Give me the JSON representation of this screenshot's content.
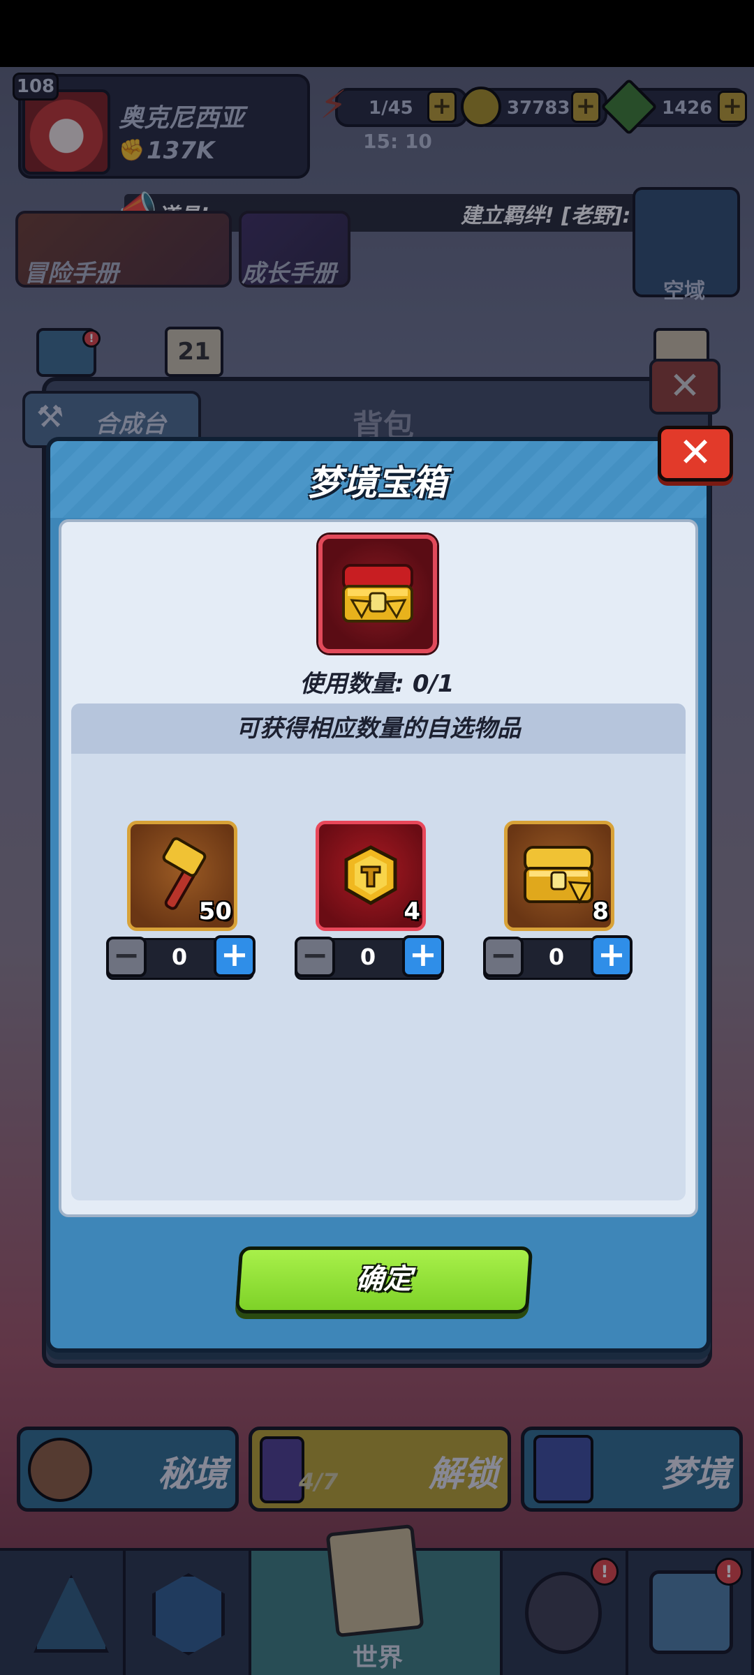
{
  "colors": {
    "modal_frame": "#3e86b8",
    "modal_body": "#e4ecf6",
    "close_red": "#e23a2a",
    "confirm_green": "#8ee035",
    "plus_blue": "#2f8ee8",
    "gold_border": "#d8a238",
    "red_border": "#e8485a"
  },
  "player": {
    "level": "108",
    "name": "奥克尼西亚",
    "power": "137K"
  },
  "resources": {
    "energy": "1/45",
    "energy_timer": "15: 10",
    "gold": "37783",
    "gems": "1426"
  },
  "ticker": {
    "left_text": "道具!",
    "right_text": "建立羁绊! [老野]:"
  },
  "menu": {
    "adventure_manual": "冒险手册",
    "growth_manual": "成长手册",
    "airspace": "空域",
    "calendar_day": "21"
  },
  "backpack": {
    "tab_label": "合成台",
    "title": "背包"
  },
  "modal": {
    "title": "梦境宝箱",
    "chest_icon": "golden-treasure-chest",
    "use_count": "使用数量: 0/1",
    "pick_header": "可获得相应数量的自选物品",
    "items": [
      {
        "icon": "golden-hammer",
        "quantity": "50",
        "selected": "0",
        "rarity": "gold"
      },
      {
        "icon": "gold-rune-coin",
        "quantity": "4",
        "selected": "0",
        "rarity": "red"
      },
      {
        "icon": "golden-chest",
        "quantity": "8",
        "selected": "0",
        "rarity": "gold"
      }
    ],
    "confirm_label": "确定"
  },
  "bottom_buttons": {
    "secret": "秘境",
    "unlock": "解锁",
    "unlock_count": "4/7",
    "dream": "梦境"
  },
  "navbar": {
    "world": "世界",
    "alert_badge": "!"
  }
}
